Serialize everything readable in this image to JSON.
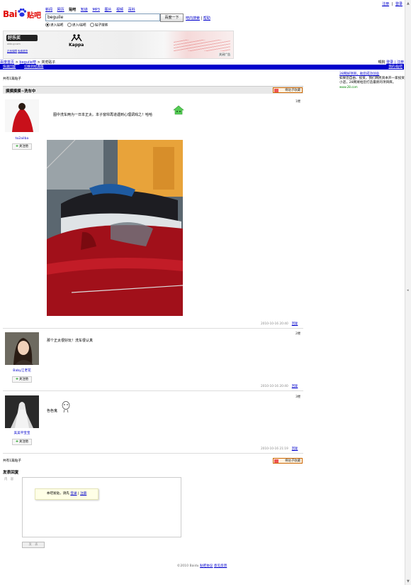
{
  "top_links": [
    "注册",
    "登录"
  ],
  "logo": {
    "bai": "Bai",
    "tieba": "贴吧"
  },
  "nav": [
    "新闻",
    "网页",
    "贴吧",
    "知道",
    "MP3",
    "图片",
    "视频",
    "百科"
  ],
  "search": {
    "value": "beguile",
    "button": "百度一下",
    "links": [
      "吧内搜索",
      "帮助"
    ]
  },
  "radios": [
    "进入贴吧",
    "进入i贴吧",
    "贴子搜索"
  ],
  "banner": {
    "brand": "好乐买",
    "sub": "okbuy.com",
    "kappa": "Kappa",
    "close": "关闭广告",
    "bottom_links": [
      "正品保障",
      "免费退货"
    ]
  },
  "crumb": {
    "home": "百度首页",
    "bar": "beguile吧",
    "sep": ">",
    "current": "浏览贴子",
    "right_prefix": "喂狗",
    "right_links": [
      "登录 | ",
      "注册"
    ]
  },
  "bluebar": {
    "left": [
      "快速回复",
      "切换到经典版"
    ],
    "right": "我的i贴吧"
  },
  "ad": {
    "title": "28网好项目，助您成功创业",
    "body": "如果您自由、投资，我们网民资本开一家投资小店，28网将给您打造最新的项目库。",
    "url": "www.28.com"
  },
  "thread": {
    "count": "共有1篇贴子",
    "title": "摸摸摸摸~洗车中",
    "collect": "将贴子收藏",
    "posts": [
      {
        "user": "to2ailba",
        "follow": "关注他",
        "floor": "1楼",
        "text": "图中洗车两为一日本正太。本子窗帘再道遇到心理调戏之！哈哈",
        "time": "2010-10-16 20:40",
        "reply": "回复"
      },
      {
        "user": "Baby江老花",
        "follow": "关注他",
        "floor": "2楼",
        "text": "那个正太很好玩！洗车很认真",
        "time": "2010-10-16 20:40",
        "reply": "回复"
      },
      {
        "user": "美美平宝宝",
        "follow": "关注他",
        "floor": "3楼",
        "text": "色色鬼",
        "time": "2010-10-16 21:19",
        "reply": "回复"
      }
    ],
    "bottom_count": "共有1篇贴子",
    "bottom_collect": "将贴子收藏"
  },
  "reply": {
    "title": "发表回复",
    "label": "内　容",
    "tip_prefix": "本吧发贴，请先",
    "tip_login": "登录",
    "tip_sep": "|",
    "tip_register": "注册",
    "submit": "发　表"
  },
  "footer": {
    "copyright": "©2010 Baidu",
    "links": [
      "贴吧协议",
      "意见反馈"
    ]
  }
}
